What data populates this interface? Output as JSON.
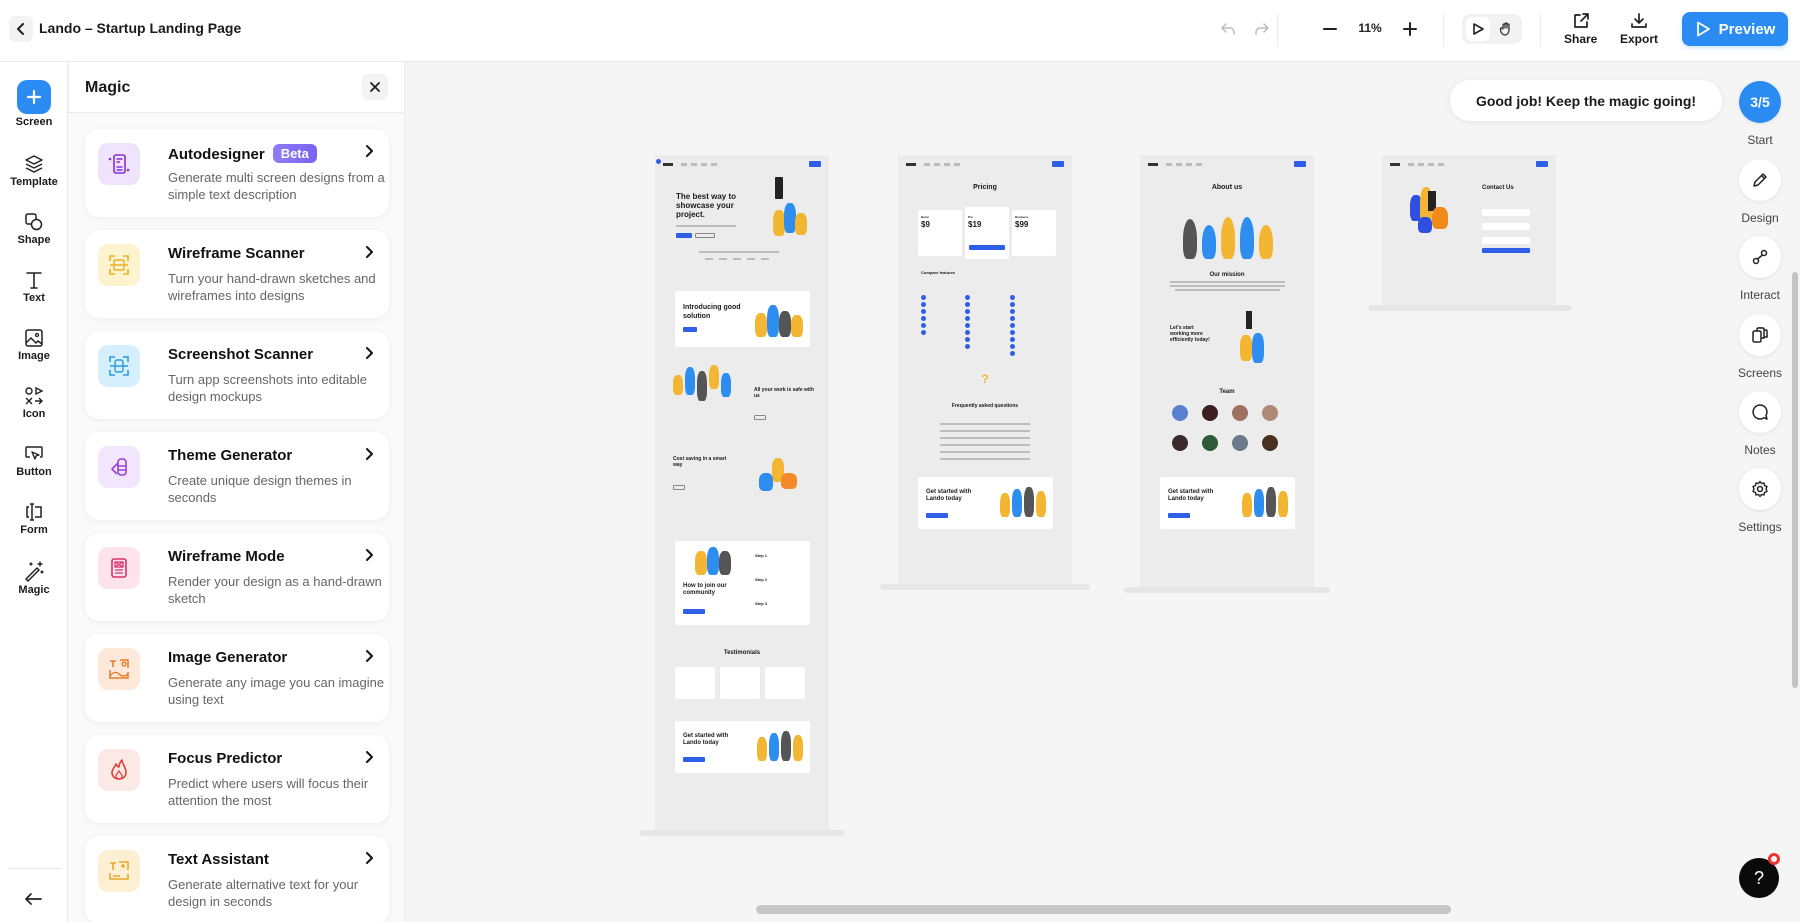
{
  "header": {
    "title": "Lando – Startup Landing Page",
    "zoom_level": "11%",
    "share_label": "Share",
    "export_label": "Export",
    "preview_label": "Preview"
  },
  "left_rail": {
    "items": [
      {
        "label": "Screen",
        "icon": "plus-icon"
      },
      {
        "label": "Template",
        "icon": "layers-icon"
      },
      {
        "label": "Shape",
        "icon": "shape-icon"
      },
      {
        "label": "Text",
        "icon": "text-icon"
      },
      {
        "label": "Image",
        "icon": "image-icon"
      },
      {
        "label": "Icon",
        "icon": "icon-set-icon"
      },
      {
        "label": "Button",
        "icon": "button-cursor-icon"
      },
      {
        "label": "Form",
        "icon": "form-field-icon"
      },
      {
        "label": "Magic",
        "icon": "magic-wand-icon"
      }
    ]
  },
  "magic_panel": {
    "title": "Magic",
    "cards": [
      {
        "title": "Autodesigner",
        "badge": "Beta",
        "description": "Generate multi screen designs from a simple text description",
        "icon": "autodesigner-icon",
        "icon_bg": "#efe4fb",
        "icon_color": "#8a2ed1"
      },
      {
        "title": "Wireframe Scanner",
        "description": "Turn your hand-drawn sketches and wireframes into designs",
        "icon": "wireframe-scanner-icon",
        "icon_bg": "#fdf3cf",
        "icon_color": "#e8b125"
      },
      {
        "title": "Screenshot Scanner",
        "description": "Turn app screenshots into editable design mockups",
        "icon": "screenshot-scanner-icon",
        "icon_bg": "#d6effd",
        "icon_color": "#2a9be0"
      },
      {
        "title": "Theme Generator",
        "description": "Create unique design themes in seconds",
        "icon": "theme-generator-icon",
        "icon_bg": "#f1e6fb",
        "icon_color": "#9a3fd6"
      },
      {
        "title": "Wireframe Mode",
        "description": "Render your design as a hand-drawn sketch",
        "icon": "wireframe-mode-icon",
        "icon_bg": "#fde4ec",
        "icon_color": "#d6336c"
      },
      {
        "title": "Image Generator",
        "description": "Generate any image you can imagine using text",
        "icon": "image-generator-icon",
        "icon_bg": "#fde9d9",
        "icon_color": "#ea7a2a"
      },
      {
        "title": "Focus Predictor",
        "description": "Predict where users will focus their attention the most",
        "icon": "flame-icon",
        "icon_bg": "#fbe9e6",
        "icon_color": "#e0413a"
      },
      {
        "title": "Text Assistant",
        "description": "Generate alternative text for your design in seconds",
        "icon": "text-assistant-icon",
        "icon_bg": "#fdf0d2",
        "icon_color": "#eba42a"
      }
    ]
  },
  "canvas": {
    "toast": "Good job! Keep the magic going!",
    "screens": [
      {
        "name": "home",
        "headings": [
          "The best way to showcase your project.",
          "Introducing good solution",
          "All your work is safe with us",
          "Cost saving in a smart way",
          "How to join our community",
          "Testimonials",
          "Get started with Lando today"
        ],
        "steps": [
          "Step 1",
          "Step 2",
          "Step 3"
        ]
      },
      {
        "name": "pricing",
        "headings": [
          "Pricing",
          "Compare features",
          "Frequently asked questions",
          "Get started with Lando today"
        ],
        "prices": [
          "$9",
          "$19",
          "$99"
        ],
        "plans": [
          "Basic",
          "Pro",
          "Business"
        ]
      },
      {
        "name": "about",
        "headings": [
          "About us",
          "Our mission",
          "Let's start working more efficiently today!",
          "Team",
          "Get started with Lando today"
        ]
      },
      {
        "name": "contact",
        "headings": [
          "Contact Us"
        ]
      }
    ]
  },
  "right_rail": {
    "progress": "3/5",
    "items": [
      {
        "label": "Start"
      },
      {
        "label": "Design",
        "icon": "pencil-icon"
      },
      {
        "label": "Interact",
        "icon": "interact-icon"
      },
      {
        "label": "Screens",
        "icon": "screens-icon"
      },
      {
        "label": "Notes",
        "icon": "note-bubble-icon"
      },
      {
        "label": "Settings",
        "icon": "gear-icon"
      }
    ]
  },
  "help": {
    "label": "?"
  }
}
